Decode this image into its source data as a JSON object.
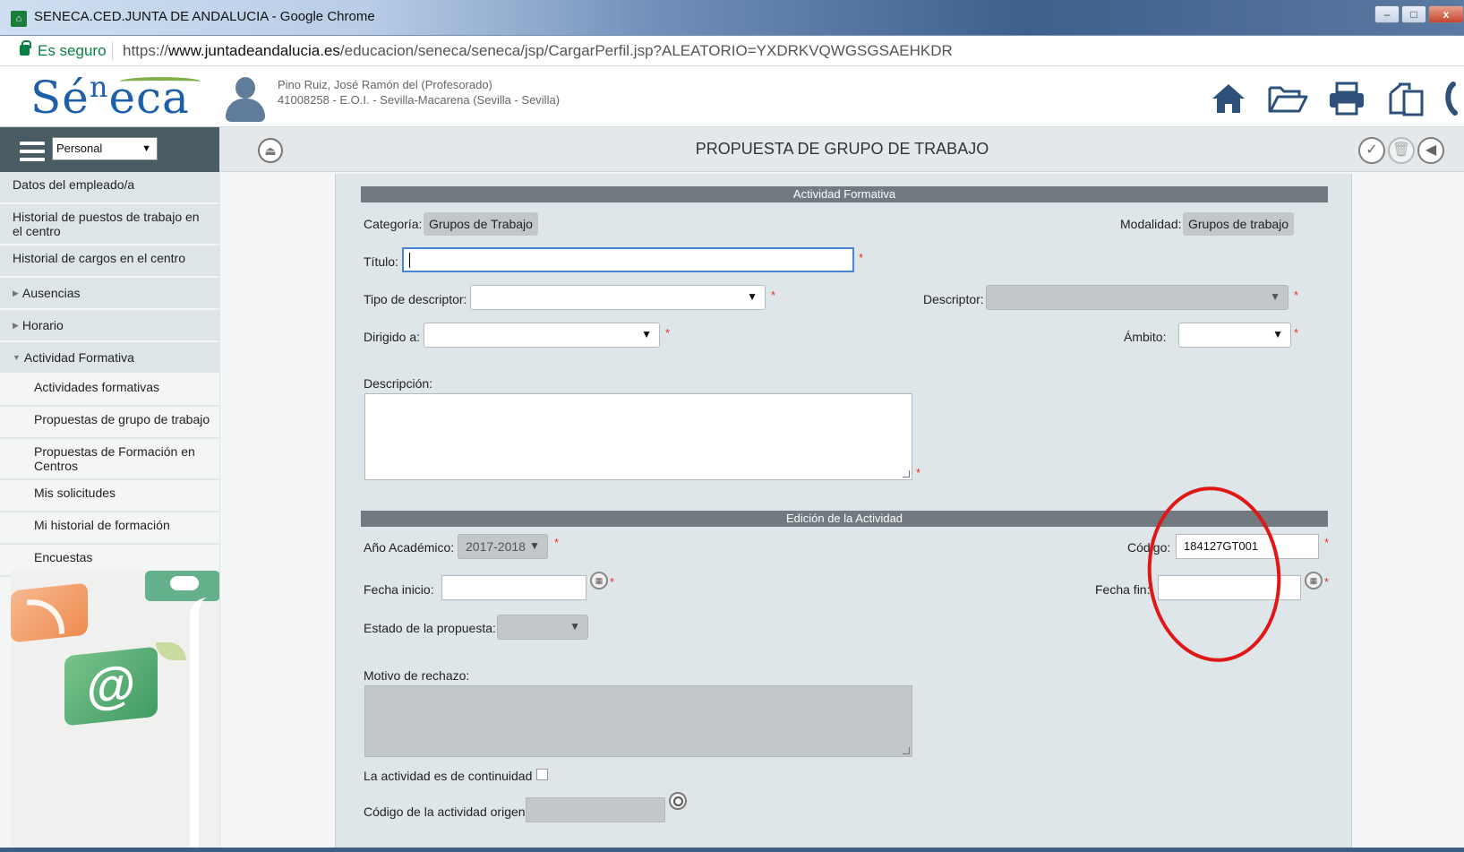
{
  "browser": {
    "window_title": "SENECA.CED.JUNTA DE ANDALUCIA - Google Chrome",
    "secure_label": "Es seguro",
    "url_prefix": "https://",
    "url_domain": "www.juntadeandalucia.es",
    "url_path": "/educacion/seneca/seneca/jsp/CargarPerfil.jsp?ALEATORIO=YXDRKVQWGSGSAEHKDR",
    "window_buttons": [
      "minimize",
      "maximize",
      "close"
    ]
  },
  "header": {
    "logo_text_pre": "Sé",
    "logo_text_sup": "n",
    "logo_text_post": "eca",
    "user_name": "Pino Ruiz, José Ramón del (Profesorado)",
    "user_center": "41008258 - E.O.I. - Sevilla-Macarena (Sevilla - Sevilla)",
    "icons": [
      "home-icon",
      "folder-open-icon",
      "print-icon",
      "copy-icon",
      "phone-icon"
    ]
  },
  "sidebar": {
    "profile_selected": "Personal",
    "items": [
      {
        "label": "Datos del empleado/a",
        "type": "item"
      },
      {
        "label": "Historial de puestos de trabajo en el centro",
        "type": "item"
      },
      {
        "label": "Historial de cargos en el centro",
        "type": "item"
      },
      {
        "label": "Ausencias",
        "type": "collapsed"
      },
      {
        "label": "Horario",
        "type": "collapsed"
      },
      {
        "label": "Actividad Formativa",
        "type": "expanded"
      },
      {
        "label": "Actividades formativas",
        "type": "sub"
      },
      {
        "label": "Propuestas de grupo de trabajo",
        "type": "sub"
      },
      {
        "label": "Propuestas de Formación en Centros",
        "type": "sub"
      },
      {
        "label": "Mis solicitudes",
        "type": "sub"
      },
      {
        "label": "Mi historial de formación",
        "type": "sub"
      },
      {
        "label": "Encuestas",
        "type": "sub"
      }
    ]
  },
  "page": {
    "title": "PROPUESTA DE GRUPO DE TRABAJO"
  },
  "form": {
    "section1_title": "Actividad Formativa",
    "categoria_label": "Categoría:",
    "categoria_value": "Grupos de Trabajo",
    "modalidad_label": "Modalidad:",
    "modalidad_value": "Grupos de trabajo",
    "titulo_label": "Título:",
    "titulo_value": "",
    "tipo_descriptor_label": "Tipo de descriptor:",
    "tipo_descriptor_value": "",
    "descriptor_label": "Descriptor:",
    "descriptor_value": "",
    "dirigido_label": "Dirigido a:",
    "dirigido_value": "",
    "ambito_label": "Ámbito:",
    "ambito_value": "",
    "descripcion_label": "Descripción:",
    "descripcion_value": "",
    "section2_title": "Edición de la Actividad",
    "anio_label": "Año Académico:",
    "anio_value": "2017-2018",
    "codigo_label": "Código:",
    "codigo_value": "184127GT001",
    "fecha_inicio_label": "Fecha inicio:",
    "fecha_inicio_value": "",
    "fecha_fin_label": "Fecha fin:",
    "fecha_fin_value": "",
    "estado_label": "Estado de la propuesta:",
    "estado_value": "",
    "motivo_label": "Motivo de rechazo:",
    "motivo_value": "",
    "continuidad_label": "La actividad es de continuidad",
    "codigo_origen_label": "Código de la actividad origen:",
    "required_mark": "*",
    "colors": {
      "highlight_circle": "#e01717",
      "section_bar": "#707a80",
      "link_blue": "#1f5fa8"
    }
  }
}
